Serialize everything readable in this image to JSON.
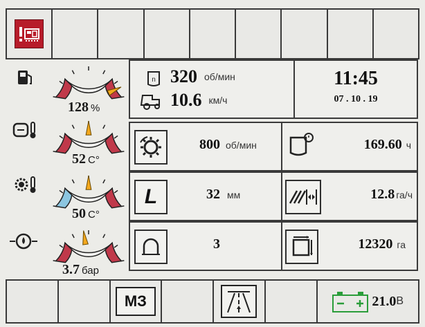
{
  "top_bar": {
    "alert_icon": "engine-warning-icon",
    "alert_color": "#b71c2a",
    "empty_slots": 8
  },
  "gauges": [
    {
      "icon": "fuel-pump-icon",
      "value": "128",
      "unit": "%",
      "level": 0.9
    },
    {
      "icon": "engine-coolant-temp-icon",
      "value": "52",
      "unit": "C°",
      "level": 0.5
    },
    {
      "icon": "transmission-oil-temp-icon",
      "value": "50",
      "unit": "C°",
      "level": 0.5
    },
    {
      "icon": "oil-pressure-icon",
      "value": "3.7",
      "unit": "бар",
      "level": 0.45
    }
  ],
  "engine": {
    "rpm": "320",
    "rpm_unit": "об/мин",
    "speed": "10.6",
    "speed_unit": "км/ч"
  },
  "clock": {
    "time": "11:45",
    "date": "07 . 10 . 19"
  },
  "rows": [
    {
      "left": {
        "icon": "pto-speed-icon",
        "value": "800",
        "unit": "об/мин"
      },
      "right": {
        "icon": "engine-hours-icon",
        "value": "169.60",
        "unit": "ч"
      }
    },
    {
      "left": {
        "icon": "width-l-icon",
        "icon_text": "L",
        "value": "32",
        "unit": "мм"
      },
      "right": {
        "icon": "area-rate-icon",
        "value": "12.8",
        "unit": "га/ч"
      }
    },
    {
      "left": {
        "icon": "arch-counter-icon",
        "value": "3",
        "unit": ""
      },
      "right": {
        "icon": "area-total-icon",
        "value": "12320",
        "unit": "га"
      }
    }
  ],
  "bottom_bar": {
    "mz_label": "МЗ",
    "road_icon": "road-lane-icon",
    "battery_icon": "battery-icon",
    "battery_value": "21.0",
    "battery_unit": "В",
    "battery_color": "#2a9d3a"
  },
  "colors": {
    "red": "#c0394a",
    "orange": "#f4a81d",
    "blue": "#8cc6e0",
    "frame": "#3a3a3a"
  }
}
